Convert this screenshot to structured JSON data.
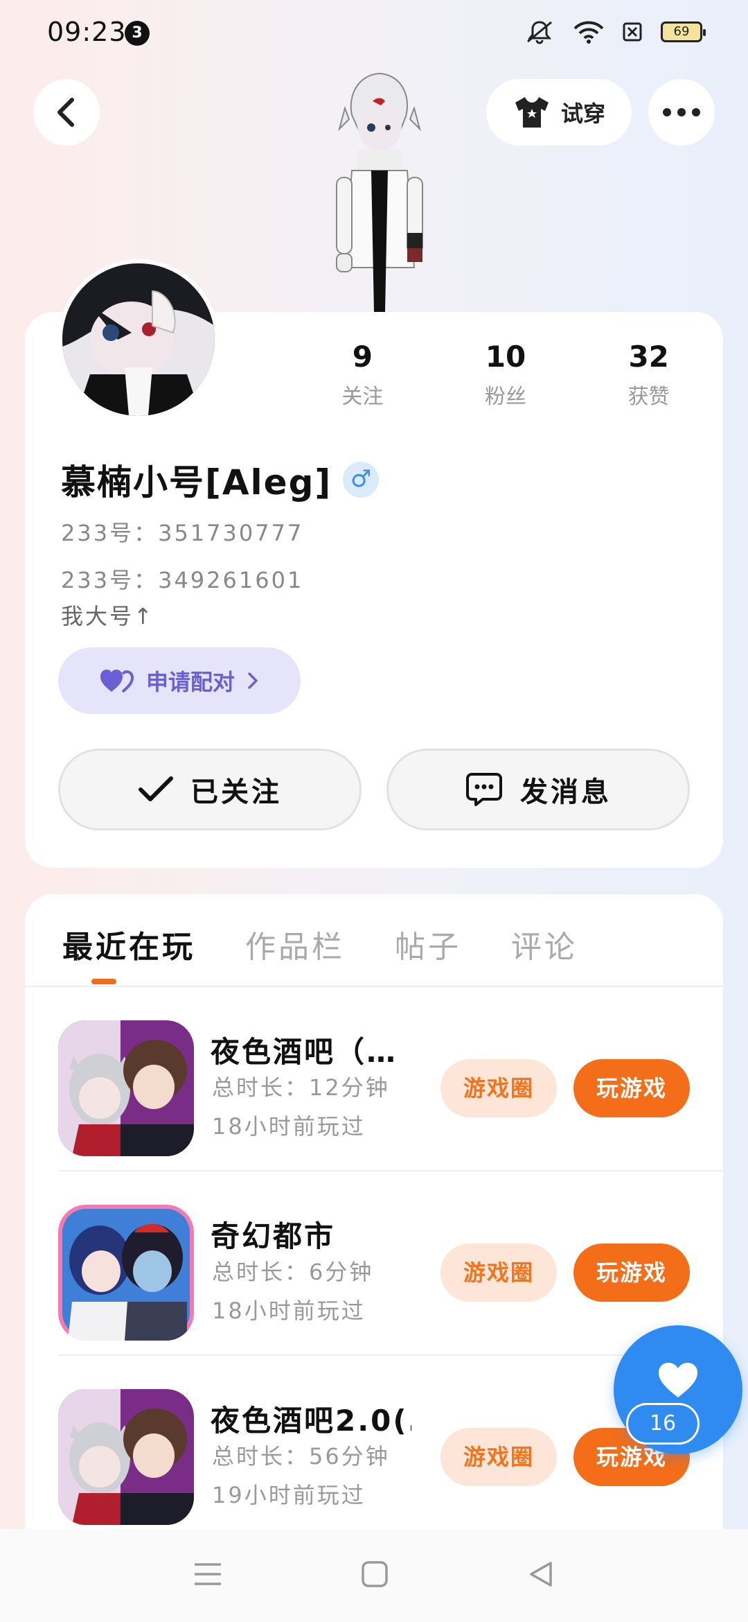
{
  "status_bar": {
    "time": "09:23",
    "notification_count": "3",
    "battery": "69"
  },
  "header": {
    "try_on_label": "试穿"
  },
  "profile": {
    "stats": [
      {
        "value": "9",
        "label": "关注"
      },
      {
        "value": "10",
        "label": "粉丝"
      },
      {
        "value": "32",
        "label": "获赞"
      }
    ],
    "username": "慕楠小号[Aleg]",
    "gender_symbol": "♂",
    "bio_lines": [
      "233号：351730777",
      "233号：349261601",
      "我大号↑"
    ],
    "match_label": "申请配对",
    "follow_label": "已关注",
    "message_label": "发消息"
  },
  "tabs": [
    {
      "label": "最近在玩",
      "active": true
    },
    {
      "label": "作品栏",
      "active": false
    },
    {
      "label": "帖子",
      "active": false
    },
    {
      "label": "评论",
      "active": false
    }
  ],
  "games": [
    {
      "title": "夜色酒吧（…",
      "duration": "总时长：12分钟",
      "last_played": "18小时前玩过",
      "circle_label": "游戏圈",
      "play_label": "玩游戏"
    },
    {
      "title": "奇幻都市",
      "duration": "总时长：6分钟",
      "last_played": "18小时前玩过",
      "circle_label": "游戏圈",
      "play_label": "玩游戏"
    },
    {
      "title": "夜色酒吧2.0(…",
      "duration": "总时长：56分钟",
      "last_played": "19小时前玩过",
      "circle_label": "游戏圈",
      "play_label": "玩游戏"
    }
  ],
  "like_fab": {
    "count": "16"
  },
  "colors": {
    "accent_orange": "#f46d18",
    "accent_blue": "#2f8bf0",
    "match_purple": "#6b5fd6"
  }
}
